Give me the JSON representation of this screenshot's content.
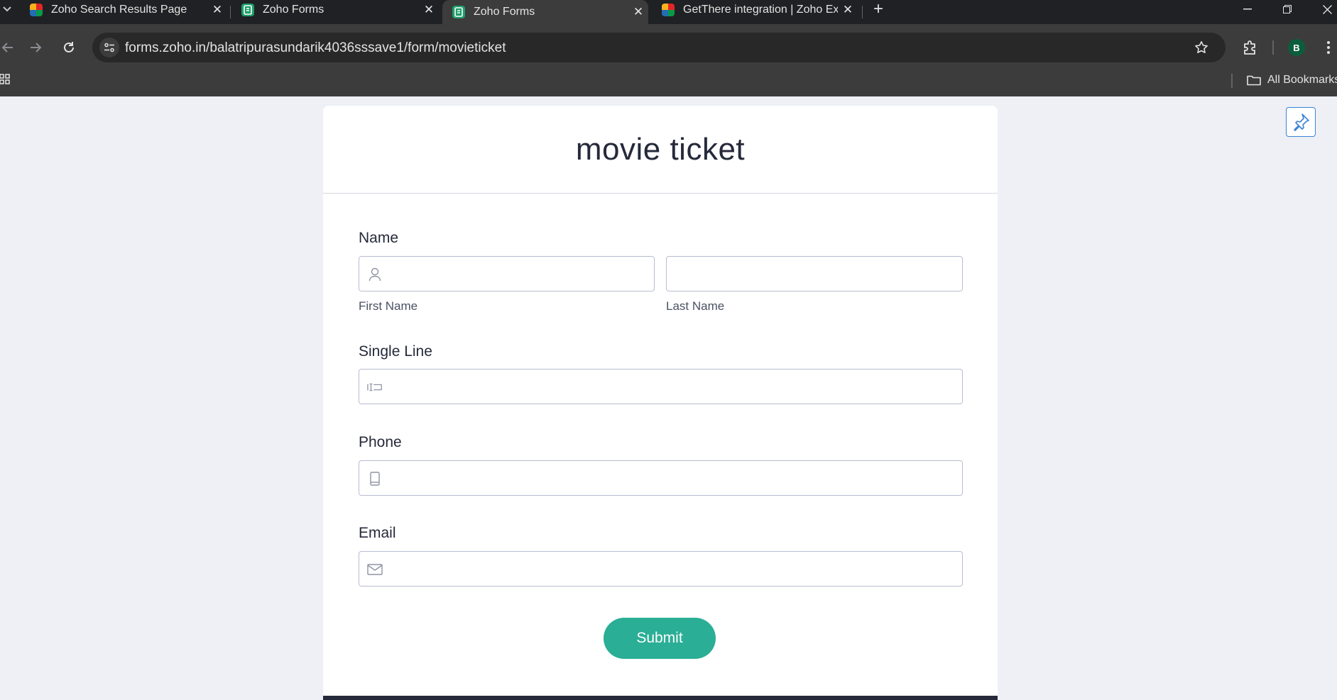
{
  "browser": {
    "tabs": [
      {
        "title": "Zoho Search Results Page",
        "favicon": "zoho-multicolor-icon"
      },
      {
        "title": "Zoho Forms",
        "favicon": "zoho-forms-icon"
      },
      {
        "title": "Zoho Forms",
        "favicon": "zoho-forms-icon",
        "active": true
      },
      {
        "title": "GetThere integration | Zoho Exp",
        "favicon": "zoho-multicolor-icon"
      }
    ],
    "url": "forms.zoho.in/balatripurasundarik4036sssave1/form/movieticket",
    "profile_initial": "B",
    "all_bookmarks_label": "All Bookmarks"
  },
  "form": {
    "title": "movie ticket",
    "fields": {
      "name": {
        "label": "Name",
        "first_sublabel": "First Name",
        "last_sublabel": "Last Name",
        "first_value": "",
        "last_value": ""
      },
      "single_line": {
        "label": "Single Line",
        "value": ""
      },
      "phone": {
        "label": "Phone",
        "value": ""
      },
      "email": {
        "label": "Email",
        "value": ""
      }
    },
    "submit_label": "Submit"
  },
  "colors": {
    "accent": "#2aae95",
    "title_text": "#25293a",
    "page_bg": "#eef0f6",
    "pin_border": "#3b84d6"
  }
}
